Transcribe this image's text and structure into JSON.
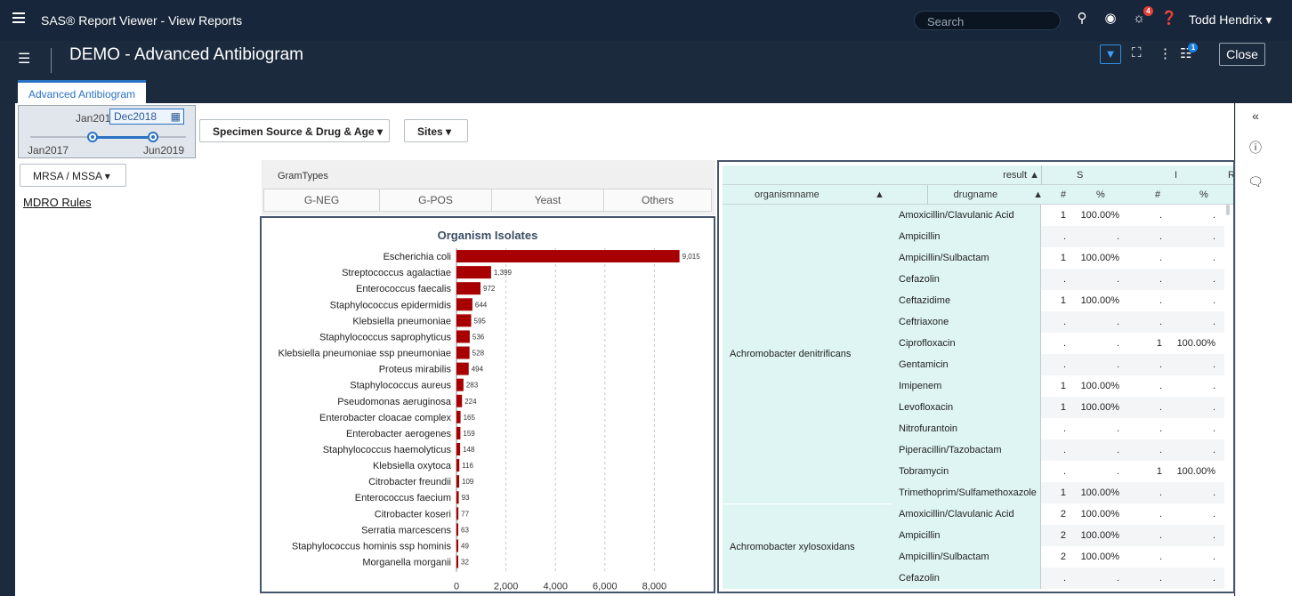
{
  "topbar": {
    "app_title": "SAS® Report Viewer - View Reports",
    "search_placeholder": "Search",
    "notification_count": "4",
    "user_name": "Todd Hendrix"
  },
  "header": {
    "report_title": "DEMO - Advanced Antibiogram",
    "notes_count": "1",
    "close_label": "Close"
  },
  "tab": {
    "label": "Advanced Antibiogram"
  },
  "slider": {
    "start_value": "Jan2017",
    "end_value": "Dec2018",
    "min_label": "Jan2017",
    "max_label": "Jun2019",
    "start_partial": "Jan201"
  },
  "filters": {
    "specimen_label": "Specimen Source & Drug & Age",
    "sites_label": "Sites",
    "mrsa_label": "MRSA / MSSA",
    "mdro_label": "MDRO Rules"
  },
  "gram": {
    "label": "GramTypes",
    "buttons": [
      "G-NEG",
      "G-POS",
      "Yeast",
      "Others"
    ]
  },
  "chart_data": {
    "type": "bar",
    "orientation": "horizontal",
    "title": "Organism Isolates",
    "categories": [
      "Escherichia coli",
      "Streptococcus agalactiae",
      "Enterococcus faecalis",
      "Staphylococcus epidermidis",
      "Klebsiella pneumoniae",
      "Staphylococcus saprophyticus",
      "Klebsiella pneumoniae ssp pneumoniae",
      "Proteus mirabilis",
      "Staphylococcus aureus",
      "Pseudomonas aeruginosa",
      "Enterobacter cloacae complex",
      "Enterobacter aerogenes",
      "Staphylococcus haemolyticus",
      "Klebsiella oxytoca",
      "Citrobacter freundii",
      "Enterococcus faecium",
      "Citrobacter koseri",
      "Serratia marcescens",
      "Staphylococcus hominis ssp hominis",
      "Morganella morganii"
    ],
    "values": [
      9015,
      1399,
      972,
      644,
      595,
      536,
      528,
      494,
      283,
      224,
      165,
      159,
      148,
      116,
      109,
      93,
      77,
      63,
      49,
      32
    ],
    "value_labels": [
      "9,015",
      "1,399",
      "972",
      "644",
      "595",
      "536",
      "528",
      "494",
      "283",
      "224",
      "165",
      "159",
      "148",
      "116",
      "109",
      "93",
      "77",
      "63",
      "49",
      "32"
    ],
    "xticks": [
      "0",
      "2,000",
      "4,000",
      "6,000",
      "8,000"
    ],
    "xlim": [
      0,
      9100
    ],
    "bar_color": "#a80000",
    "grid": true
  },
  "table": {
    "result_label": "result ▲",
    "groups": [
      "S",
      "I",
      "R"
    ],
    "col_org": "organismname",
    "col_drug": "drugname",
    "col_num": "#",
    "col_pct": "%",
    "organisms": [
      {
        "name": "Achromobacter denitrificans",
        "rows": [
          {
            "drug": "Amoxicillin/Clavulanic Acid",
            "s_n": "1",
            "s_p": "100.00%",
            "i_n": ".",
            "i_p": "."
          },
          {
            "drug": "Ampicillin",
            "s_n": ".",
            "s_p": ".",
            "i_n": ".",
            "i_p": "."
          },
          {
            "drug": "Ampicillin/Sulbactam",
            "s_n": "1",
            "s_p": "100.00%",
            "i_n": ".",
            "i_p": "."
          },
          {
            "drug": "Cefazolin",
            "s_n": ".",
            "s_p": ".",
            "i_n": ".",
            "i_p": "."
          },
          {
            "drug": "Ceftazidime",
            "s_n": "1",
            "s_p": "100.00%",
            "i_n": ".",
            "i_p": "."
          },
          {
            "drug": "Ceftriaxone",
            "s_n": ".",
            "s_p": ".",
            "i_n": ".",
            "i_p": "."
          },
          {
            "drug": "Ciprofloxacin",
            "s_n": ".",
            "s_p": ".",
            "i_n": "1",
            "i_p": "100.00%"
          },
          {
            "drug": "Gentamicin",
            "s_n": ".",
            "s_p": ".",
            "i_n": ".",
            "i_p": "."
          },
          {
            "drug": "Imipenem",
            "s_n": "1",
            "s_p": "100.00%",
            "i_n": ".",
            "i_p": "."
          },
          {
            "drug": "Levofloxacin",
            "s_n": "1",
            "s_p": "100.00%",
            "i_n": ".",
            "i_p": "."
          },
          {
            "drug": "Nitrofurantoin",
            "s_n": ".",
            "s_p": ".",
            "i_n": ".",
            "i_p": "."
          },
          {
            "drug": "Piperacillin/Tazobactam",
            "s_n": ".",
            "s_p": ".",
            "i_n": ".",
            "i_p": "."
          },
          {
            "drug": "Tobramycin",
            "s_n": ".",
            "s_p": ".",
            "i_n": "1",
            "i_p": "100.00%"
          },
          {
            "drug": "Trimethoprim/Sulfamethoxazole",
            "s_n": "1",
            "s_p": "100.00%",
            "i_n": ".",
            "i_p": "."
          }
        ]
      },
      {
        "name": "Achromobacter xylosoxidans",
        "rows": [
          {
            "drug": "Amoxicillin/Clavulanic Acid",
            "s_n": "2",
            "s_p": "100.00%",
            "i_n": ".",
            "i_p": "."
          },
          {
            "drug": "Ampicillin",
            "s_n": "2",
            "s_p": "100.00%",
            "i_n": ".",
            "i_p": "."
          },
          {
            "drug": "Ampicillin/Sulbactam",
            "s_n": "2",
            "s_p": "100.00%",
            "i_n": ".",
            "i_p": "."
          },
          {
            "drug": "Cefazolin",
            "s_n": ".",
            "s_p": ".",
            "i_n": ".",
            "i_p": "."
          }
        ]
      }
    ]
  }
}
